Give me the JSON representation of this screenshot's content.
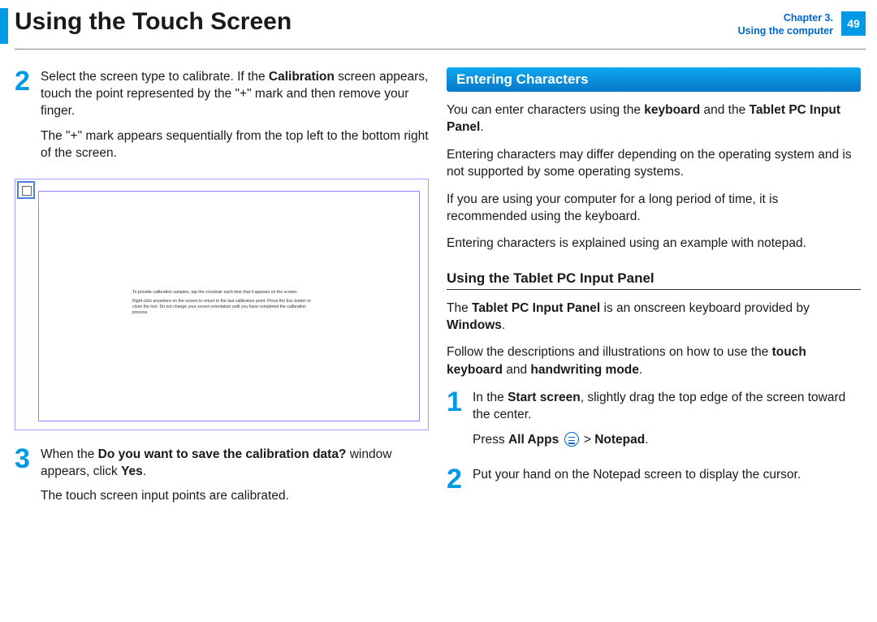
{
  "header": {
    "title": "Using the Touch Screen",
    "chapter_line1": "Chapter 3.",
    "chapter_line2": "Using the computer",
    "page_number": "49"
  },
  "left": {
    "step2_num": "2",
    "step2_p1a": "Select the screen type to calibrate. If the ",
    "step2_p1b": "Calibration",
    "step2_p1c": " screen appears, touch the point represented by the \"+\" mark and then remove your finger.",
    "step2_p2": "The \"+\" mark appears sequentially from the top left to the bottom right of the screen.",
    "fig_line1": "To provide calibration samples, tap the crosshair each time that it appears on the screen.",
    "fig_line2": "Right-click anywhere on the screen to return to the last calibration point. Press the Esc button to close the tool. Do not change your screen orientation until you have completed the calibration process.",
    "step3_num": "3",
    "step3_p1a": "When the ",
    "step3_p1b": "Do you want to save the calibration data?",
    "step3_p1c": " window appears, click ",
    "step3_p1d": "Yes",
    "step3_p1e": ".",
    "step3_p2": "The touch screen input points are calibrated."
  },
  "right": {
    "section_title": "Entering Characters",
    "p1a": "You can enter characters using the ",
    "p1b": "keyboard",
    "p1c": " and the ",
    "p1d": "Tablet PC Input Panel",
    "p1e": ".",
    "p2": "Entering characters may differ depending on the operating system and is not supported by some operating systems.",
    "p3": "If you are using your computer for a long period of time, it is recommended using the keyboard.",
    "p4": "Entering characters is explained using an example with notepad.",
    "subhead": "Using the Tablet PC Input Panel",
    "sp1a": "The ",
    "sp1b": "Tablet PC Input Panel",
    "sp1c": " is an onscreen keyboard provided by ",
    "sp1d": "Windows",
    "sp1e": ".",
    "sp2a": "Follow the descriptions and illustrations on how to use the ",
    "sp2b": "touch keyboard",
    "sp2c": " and ",
    "sp2d": "handwriting mode",
    "sp2e": ".",
    "r_step1_num": "1",
    "r_step1_p1a": "In the ",
    "r_step1_p1b": "Start screen",
    "r_step1_p1c": ", slightly drag the top edge of the screen toward the center.",
    "r_step1_p2a": "Press ",
    "r_step1_p2b": "All Apps",
    "r_step1_p2c": " > ",
    "r_step1_p2d": "Notepad",
    "r_step1_p2e": ".",
    "r_step2_num": "2",
    "r_step2_p1": "Put your hand on the Notepad screen to display the cursor."
  }
}
